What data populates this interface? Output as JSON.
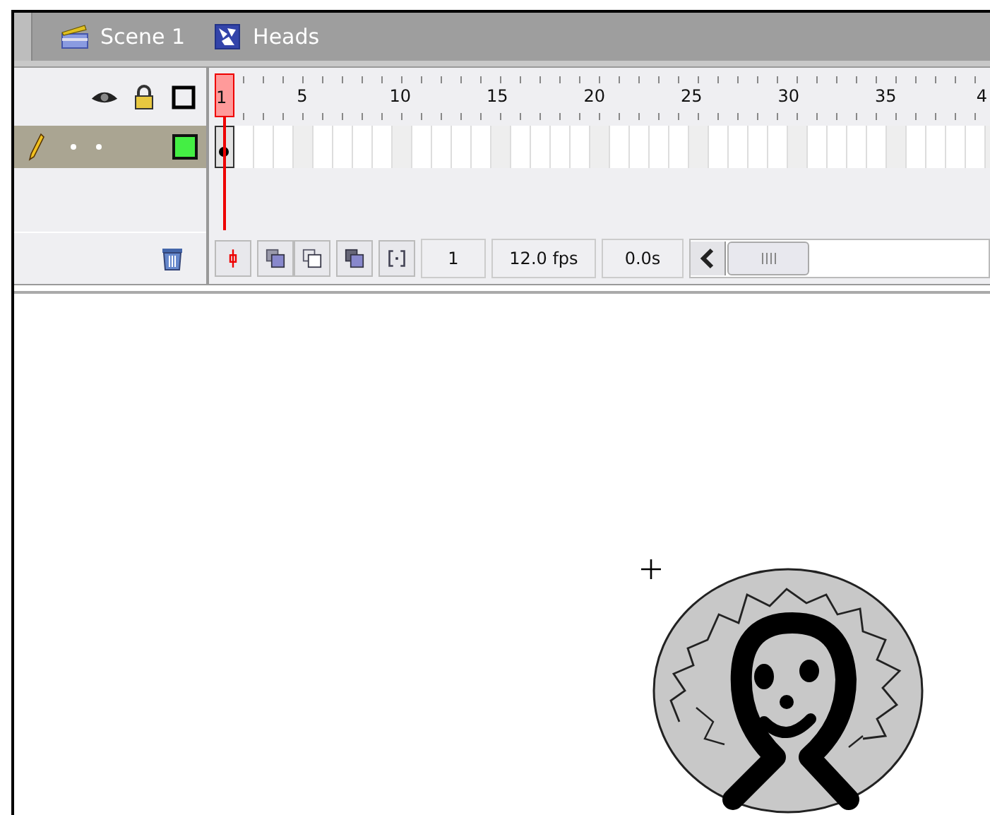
{
  "breadcrumb": [
    {
      "kind": "scene",
      "label": "Scene 1"
    },
    {
      "kind": "symbol",
      "label": "Heads"
    }
  ],
  "ruler": [
    {
      "label": "1",
      "selected": true
    },
    {
      "label": "5",
      "selected": false
    },
    {
      "label": "10",
      "selected": false
    },
    {
      "label": "15",
      "selected": false
    },
    {
      "label": "20",
      "selected": false
    },
    {
      "label": "25",
      "selected": false
    },
    {
      "label": "30",
      "selected": false
    },
    {
      "label": "35",
      "selected": false
    },
    {
      "label": "4",
      "selected": false
    }
  ],
  "layers": [
    {
      "selected": true
    }
  ],
  "status": {
    "current_frame": "1",
    "frame_rate": "12.0 fps",
    "elapsed_time": "0.0s"
  }
}
